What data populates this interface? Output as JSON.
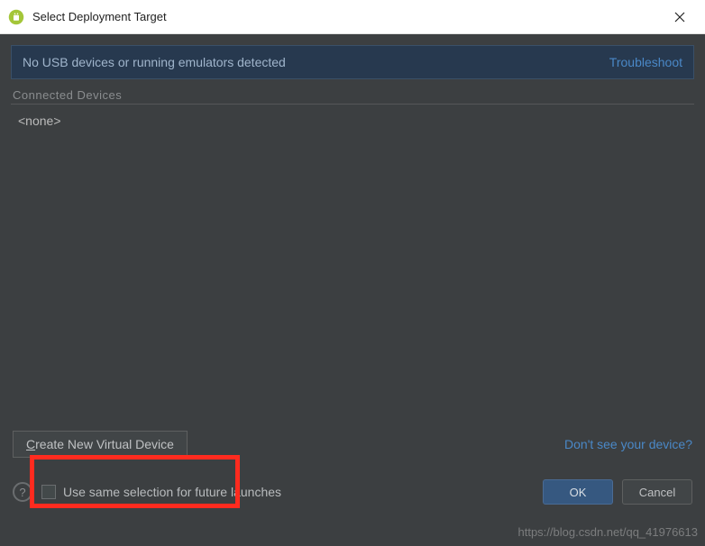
{
  "titlebar": {
    "title": "Select Deployment Target"
  },
  "banner": {
    "message": "No USB devices or running emulators detected",
    "troubleshoot": "Troubleshoot"
  },
  "devices": {
    "section_label": "Connected Devices",
    "none": "<none>"
  },
  "actions": {
    "create_device_prefix": "C",
    "create_device_rest": "reate New Virtual Device",
    "dont_see": "Don't see your device?"
  },
  "footer": {
    "help": "?",
    "checkbox_label": "Use same selection for future launches",
    "ok": "OK",
    "cancel": "Cancel"
  },
  "watermark": "https://blog.csdn.net/qq_41976613"
}
